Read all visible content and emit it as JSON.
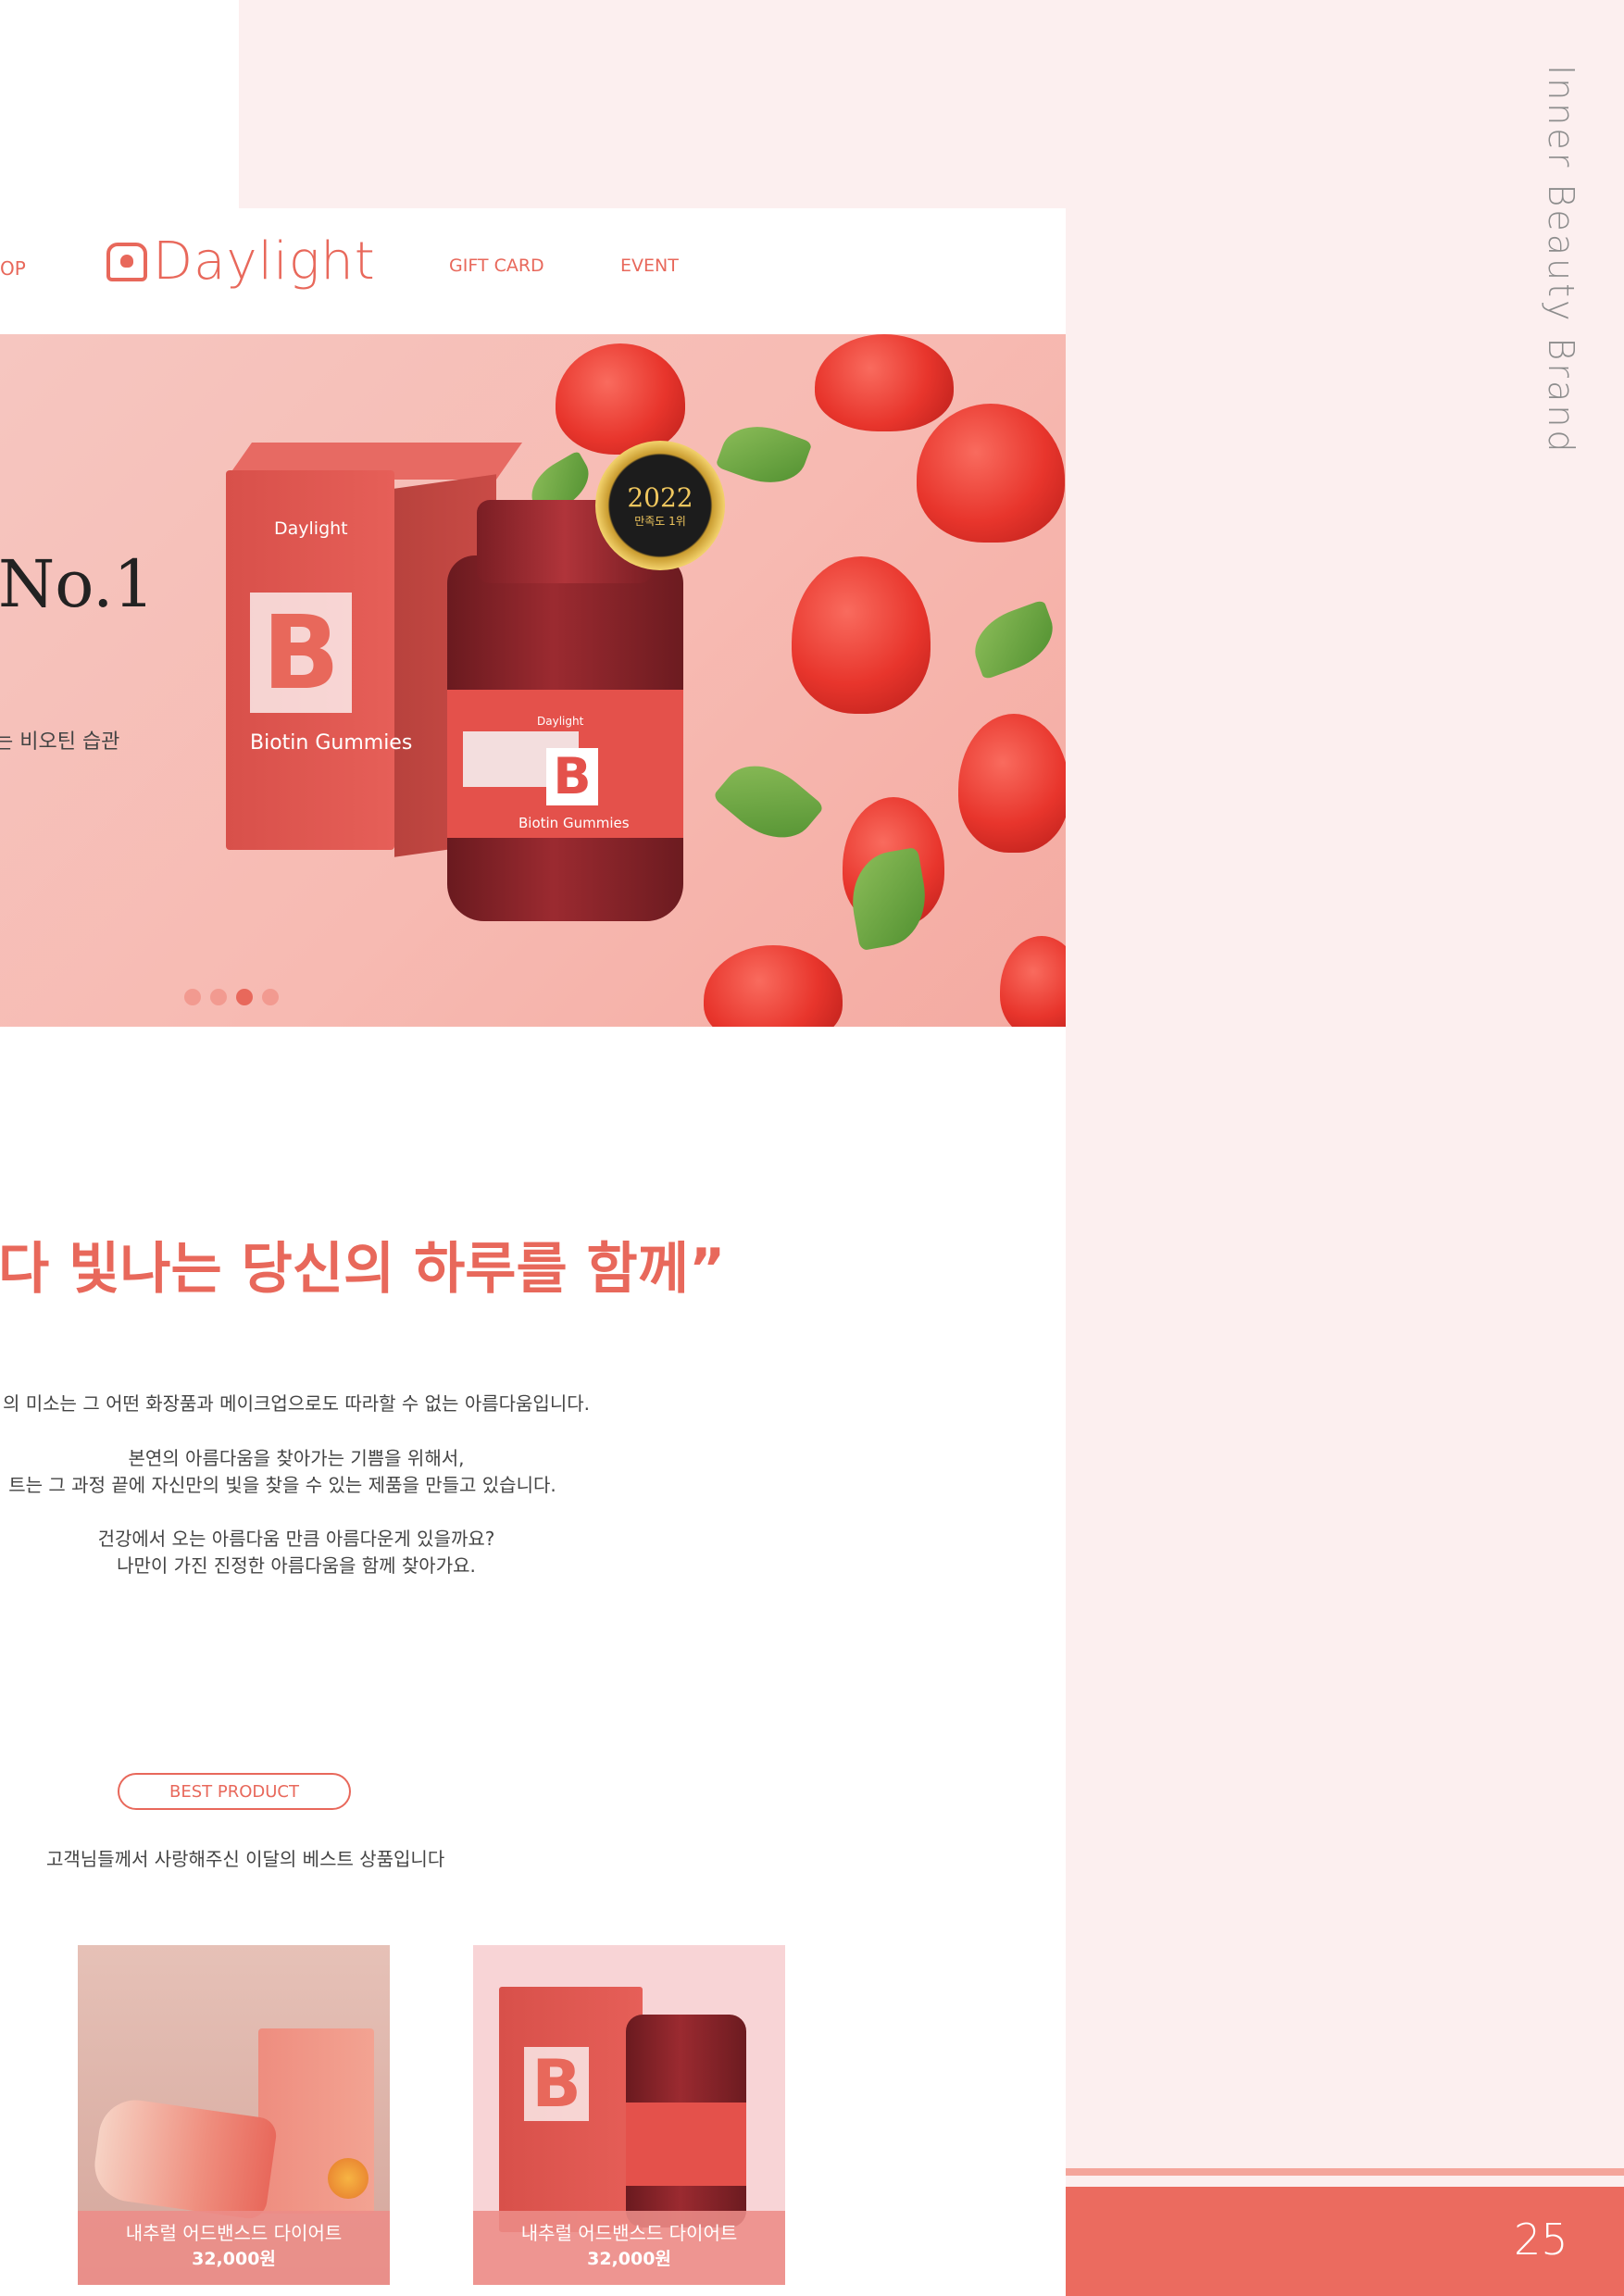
{
  "brand": {
    "vertical_title": "Inner Beauty Brand",
    "page_number": "25"
  },
  "nav": {
    "shop": "OP",
    "logo": "Daylight",
    "links": [
      "GIFT CARD",
      "EVENT"
    ]
  },
  "hero": {
    "headline": "No.1",
    "subline": "는 비오틴 습관",
    "box_logo": "Daylight",
    "box_letter": "B",
    "box_name": "Biotin Gummies",
    "jar_logo": "Daylight",
    "jar_letter": "B",
    "jar_name": "Biotin Gummies",
    "badge_year": "2022",
    "badge_text": "만족도 1위",
    "slide_count": 4,
    "active_slide": 3
  },
  "slogan": "다 빛나는 당신의 하루를 함께”",
  "body_lines": [
    "의 미소는 그 어떤 화장품과 메이크업으로도 따라할 수 없는 아름다움입니다.",
    "본연의 아름다움을 찾아가는 기쁨을 위해서,",
    "트는 그 과정 끝에 자신만의 빛을 찾을 수 있는 제품을 만들고 있습니다.",
    "건강에서 오는 아름다움 만큼 아름다운게 있을까요?",
    "나만이 가진 진정한 아름다움을 함께 찾아가요."
  ],
  "best": {
    "button": "BEST PRODUCT",
    "subtitle": "고객님들께서 사랑해주신 이달의 베스트 상품입니다",
    "products": [
      {
        "name": "내추럴 어드밴스드 다이어트",
        "price": "32,000원"
      },
      {
        "name": "내추럴 어드밴스드 다이어트",
        "price": "32,000원"
      }
    ]
  },
  "colors": {
    "accent": "#e8685b",
    "panel": "#fcefef",
    "footer": "#eb6b5f"
  }
}
